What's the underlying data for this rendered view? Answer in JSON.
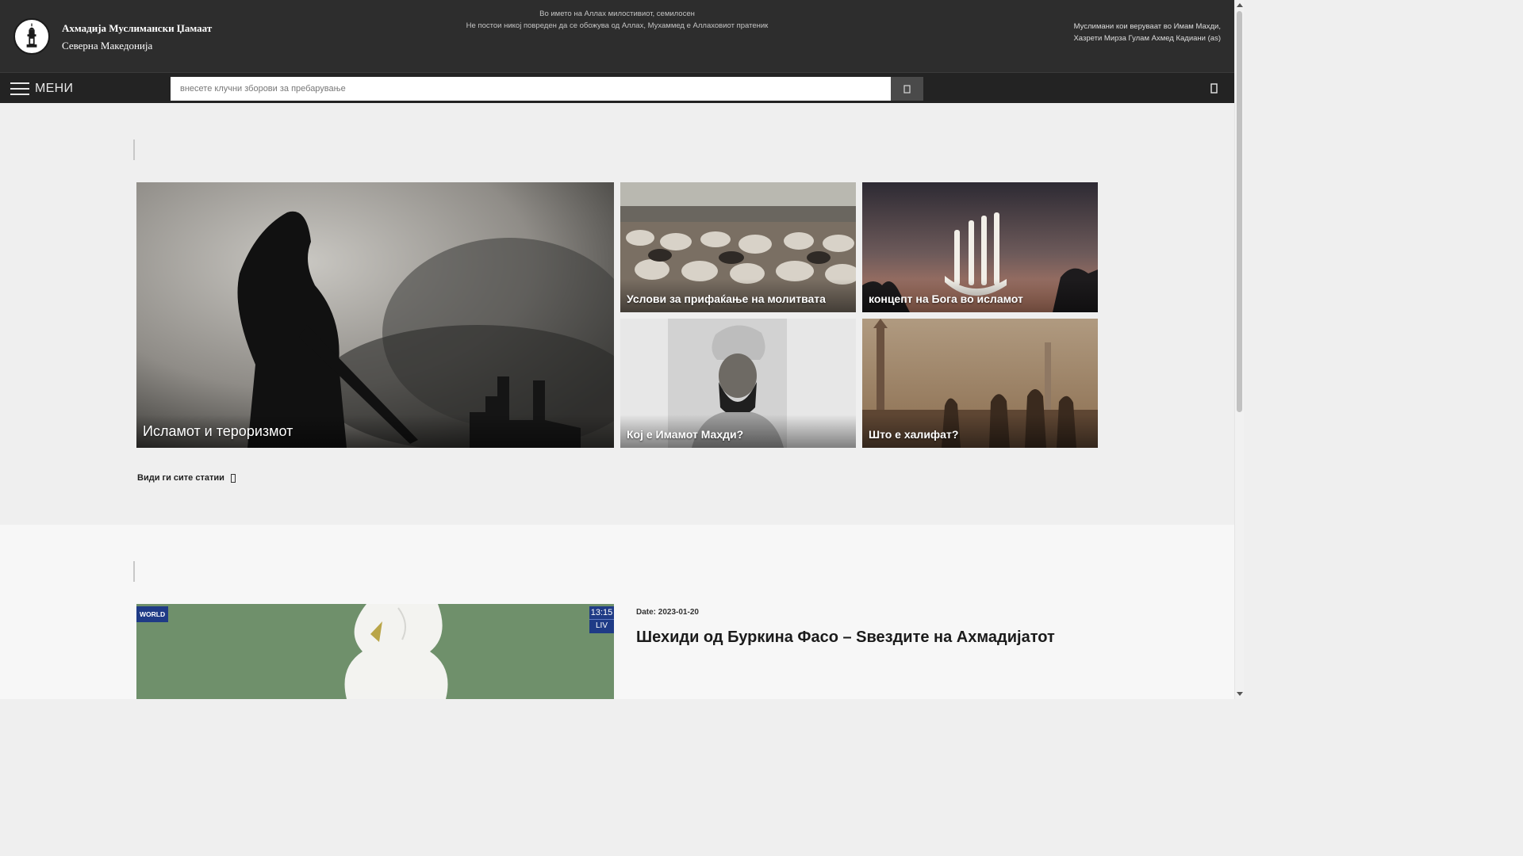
{
  "header": {
    "org_name": "Ахмадија Муслимански Џамаат",
    "org_sub": "Северна Македонија",
    "motto_line1": "Во името на Аллах милостивиот, семилосен",
    "motto_line2": "Не постои никој повреден да се обожува од Аллах, Мухаммед е Аллаховиот пратеник",
    "belief_line1": "Муслимани кои веруваат во Имам Махди,",
    "belief_line2": "Хазрети Мирза Гулам Ахмед Кадиани (as)"
  },
  "toolbar": {
    "menu_label": "МЕНИ",
    "search_placeholder": "внесете клучни зборови за пребарување",
    "search_icon": "search-icon",
    "user_icon": "user-icon"
  },
  "articles": {
    "featured": [
      {
        "title": "Исламот и тероризмот"
      },
      {
        "title": "Услови за прифаќање на молитвата"
      },
      {
        "title": "концепт на Бога во исламот"
      },
      {
        "title": "Кој е Имамот Махди?"
      },
      {
        "title": "Што е халифат?"
      }
    ],
    "see_all": "Види ги сите статии"
  },
  "news": {
    "video": {
      "channel": "WORLD",
      "time": "13:15",
      "live": "LIV"
    },
    "date": "Date: 2023-01-20",
    "title": "Шехиди од Буркина Фасо – Ѕвездите на Ахмадијатот"
  },
  "colors": {
    "header_bg": "#2d2d2d",
    "toolbar_bg": "#232323",
    "page_bg": "#efefef",
    "channel_blue": "#1f3b86"
  }
}
